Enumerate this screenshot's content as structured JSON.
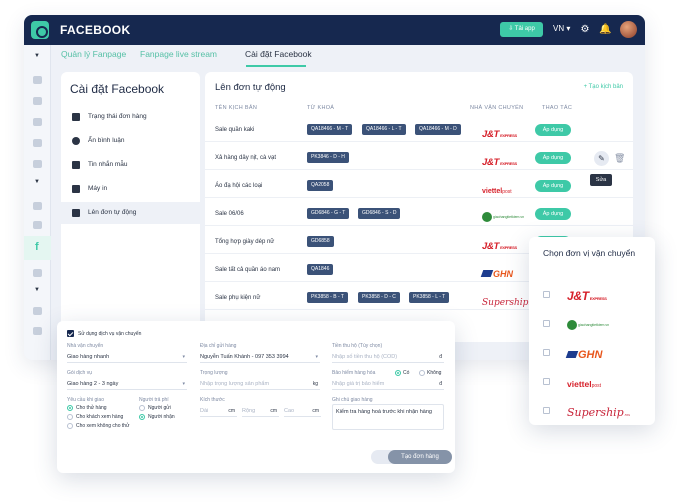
{
  "app": {
    "title": "FACEBOOK",
    "download_label": "Tải app",
    "language": "VN"
  },
  "tabs": [
    "Quản lý Fanpage",
    "Fanpage live stream",
    "Cài đặt Facebook"
  ],
  "settings": {
    "title": "Cài đặt Facebook",
    "menu": [
      "Trạng thái đơn hàng",
      "Ẩn bình luận",
      "Tin nhắn mẫu",
      "Máy in",
      "Lên đơn tự động"
    ]
  },
  "orders": {
    "title": "Lên đơn tự động",
    "add_label": "Tạo kịch bản",
    "columns": [
      "TÊN KỊCH BẢN",
      "TỪ KHOÁ",
      "NHÀ VẬN CHUYỂN",
      "THAO TÁC"
    ],
    "apply_label": "Áp dụng",
    "edit_tooltip": "Sửa",
    "rows": [
      {
        "name": "Sale quần kaki",
        "keywords": [
          "QA18466 - M - T",
          "QA18466 - L - T",
          "QA18466 - M - D"
        ],
        "carrier": "jt"
      },
      {
        "name": "Xả hàng dây nịt, cà vạt",
        "keywords": [
          "PK3846 - D - H"
        ],
        "carrier": "jt"
      },
      {
        "name": "Áo đạ hội các loại",
        "keywords": [
          "QA2058"
        ],
        "carrier": "viettel"
      },
      {
        "name": "Sale 06/06",
        "keywords": [
          "GD6846 - G - T",
          "GD6846 - S - D"
        ],
        "carrier": "giaotietkiem"
      },
      {
        "name": "Tổng hợp giày dép nữ",
        "keywords": [
          "GD6858"
        ],
        "carrier": "jt"
      },
      {
        "name": "Sale tất cả quần áo nam",
        "keywords": [
          "QA1846"
        ],
        "carrier": "ghn"
      },
      {
        "name": "Sale phụ kiện nữ",
        "keywords": [
          "PK3858 - B - T",
          "PK3858 - D - C",
          "PK3858 - L - T"
        ],
        "carrier": "supership"
      }
    ]
  },
  "logos": {
    "jt_main": "J&T",
    "jt_sub": "EXPRESS",
    "viettel_main": "viettel",
    "viettel_sub": "post",
    "ghn": "GHN",
    "supership_main": "Supership",
    "supership_sub": ".vn",
    "gtk": "giaohangtietkiem.vn"
  },
  "form": {
    "use_service_label": "Sử dụng dịch vụ vận chuyển",
    "carrier_label": "Nhà vận chuyển",
    "carrier_value": "Giao hàng nhanh",
    "package_label": "Gói dịch vụ",
    "package_value": "Giao hàng 2 - 3 ngày",
    "request_label": "Yêu cầu khi giao",
    "request_options": [
      "Cho thử hàng",
      "Cho khách xem hàng",
      "Cho xem không cho thử"
    ],
    "payer_label": "Người trả phí",
    "payer_options": [
      "Người gửi",
      "Người nhận"
    ],
    "pickup_label": "Địa chỉ gửi hàng",
    "pickup_value": "Nguyễn Tuấn Khánh - 097 353 3994",
    "weight_label": "Trọng lượng",
    "weight_placeholder": "Nhập trọng lượng sản phẩm",
    "weight_unit": "kg",
    "size_label": "Kích thước",
    "size_fields": [
      "Dài",
      "Rộng",
      "Cao"
    ],
    "size_unit": "cm",
    "cod_label": "Tiền thu hộ (Tùy chọn)",
    "cod_placeholder": "Nhập số tiền thu hộ (COD)",
    "currency": "đ",
    "insurance_label": "Bảo hiểm hàng hóa",
    "insurance_options": [
      "Có",
      "Không"
    ],
    "insurance_placeholder": "Nhập giá trị bảo hiểm",
    "note_label": "Ghi chú giao hàng",
    "note_value": "Kiểm tra hàng hoá trước khi nhận hàng",
    "draft_label": "Lưu nháp",
    "create_label": "Tạo đơn hàng"
  },
  "picker": {
    "title": "Chọn đơn vị vận chuyển",
    "carriers": [
      "jt",
      "giaotietkiem",
      "ghn",
      "viettel",
      "supership"
    ]
  },
  "colors": {
    "primary": "#3ec9a7",
    "navy": "#16284f",
    "chip": "#3b5278",
    "jt_red": "#d6202a",
    "ghn_orange": "#e8561c"
  }
}
